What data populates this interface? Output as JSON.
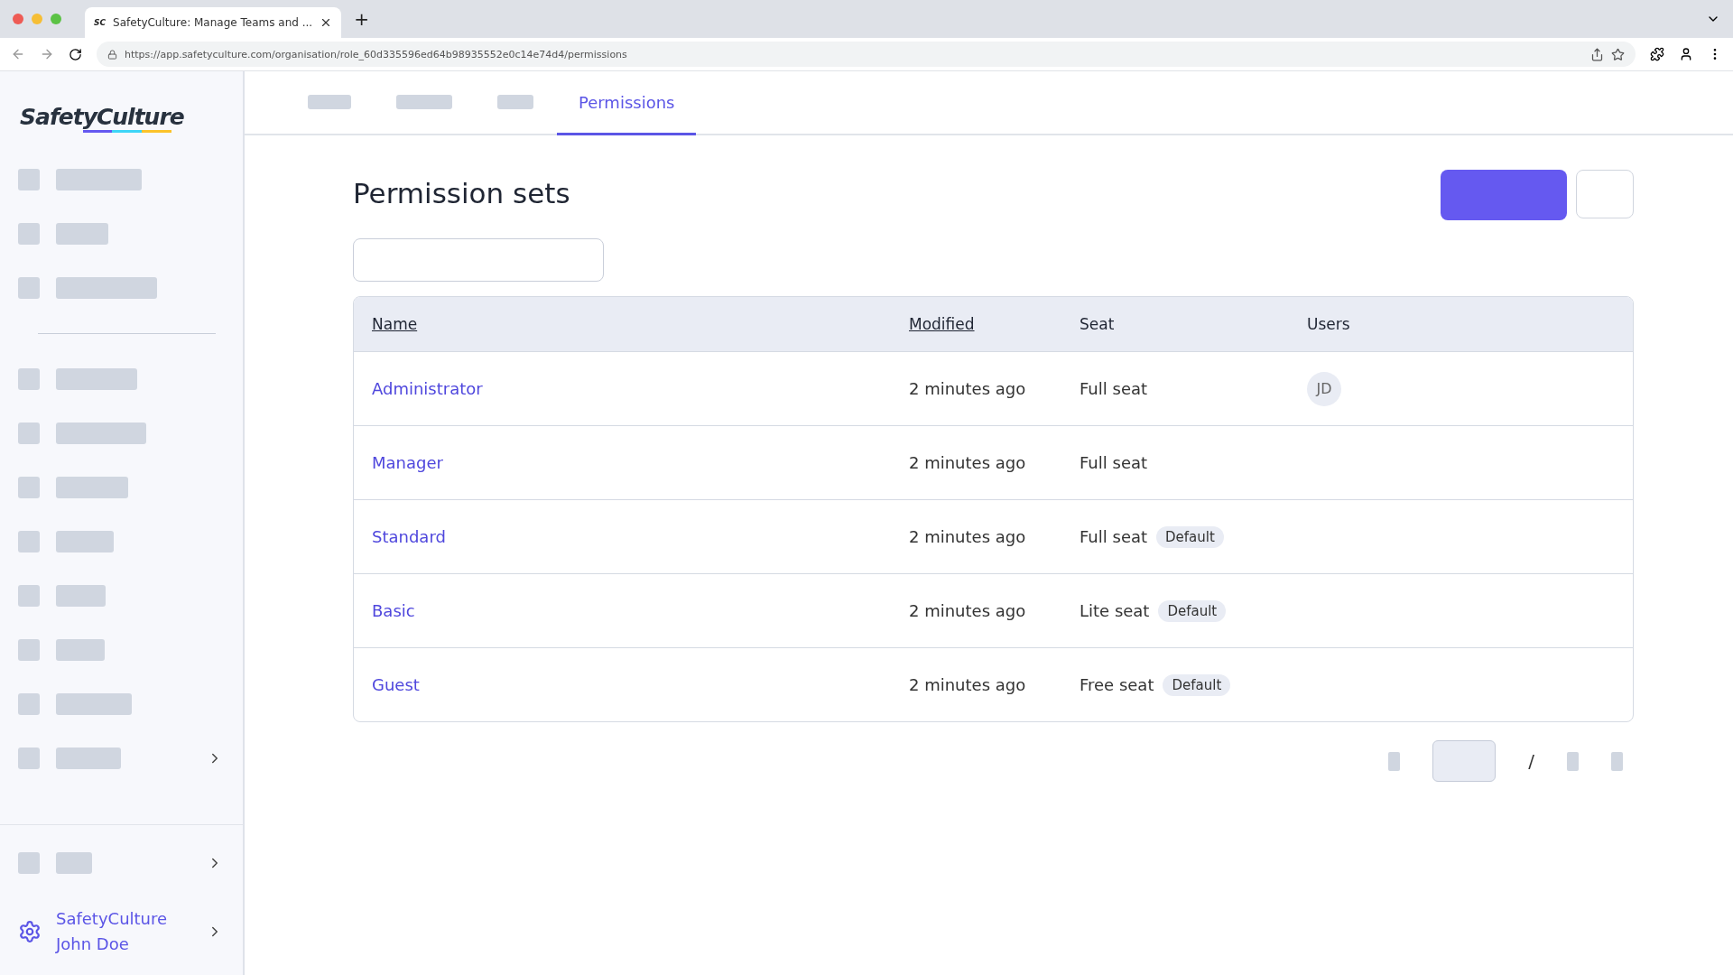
{
  "browser": {
    "favicon": "SC",
    "tab_title": "SafetyCulture: Manage Teams and ...",
    "new_tab": "+",
    "url": "https://app.safetyculture.com/organisation/role_60d335596ed64b98935552e0c14e74d4/permissions"
  },
  "logo": "SafetyCulture",
  "sidebar": {
    "items": [
      {
        "expandable": false
      },
      {
        "expandable": false
      },
      {
        "expandable": false
      },
      {
        "expandable": false
      },
      {
        "expandable": false
      },
      {
        "expandable": false
      },
      {
        "expandable": false
      },
      {
        "expandable": false
      },
      {
        "expandable": false
      },
      {
        "expandable": false
      },
      {
        "expandable": true
      }
    ],
    "footer_item": {
      "expandable": true
    },
    "account": {
      "org": "SafetyCulture",
      "user": "John Doe"
    }
  },
  "tabs": [
    {
      "kind": "hidden",
      "selected": false
    },
    {
      "kind": "hidden",
      "selected": false
    },
    {
      "kind": "hidden",
      "selected": false
    },
    {
      "kind": "label",
      "label": "Permissions",
      "selected": true
    }
  ],
  "page_title": "Permission sets",
  "table": {
    "columns": [
      {
        "label": "Name",
        "sortable": true
      },
      {
        "label": "Modified",
        "sortable": true
      },
      {
        "label": "Seat",
        "sortable": false
      },
      {
        "label": "Users",
        "sortable": false
      }
    ],
    "rows": [
      {
        "name": "Administrator",
        "modified": "2 minutes ago",
        "seat": "Full seat",
        "users": [
          "JD"
        ]
      },
      {
        "name": "Manager",
        "modified": "2 minutes ago",
        "seat": "Full seat"
      },
      {
        "name": "Standard",
        "modified": "2 minutes ago",
        "seat": "Full seat",
        "badge": "Default"
      },
      {
        "name": "Basic",
        "modified": "2 minutes ago",
        "seat": "Lite seat",
        "badge": "Default"
      },
      {
        "name": "Guest",
        "modified": "2 minutes ago",
        "seat": "Free seat",
        "badge": "Default"
      }
    ]
  },
  "pagination": {
    "separator": "/"
  }
}
